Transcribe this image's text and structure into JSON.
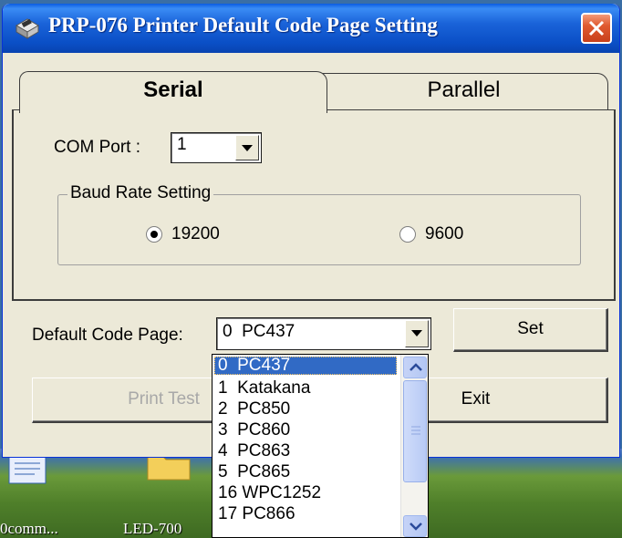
{
  "window": {
    "title": "PRP-076 Printer Default Code Page Setting"
  },
  "tabs": [
    {
      "label": "Serial",
      "active": true
    },
    {
      "label": "Parallel",
      "active": false
    }
  ],
  "serial": {
    "com_port_label": "COM Port :",
    "com_port_value": "1",
    "baud_group_title": "Baud Rate Setting",
    "baud_options": [
      {
        "label": "19200",
        "selected": true
      },
      {
        "label": "9600",
        "selected": false
      }
    ]
  },
  "code_page": {
    "label": "Default Code Page:",
    "value": "0  PC437",
    "options": [
      "0  PC437",
      "1  Katakana",
      "2  PC850",
      "3  PC860",
      "4  PC863",
      "5  PC865",
      "16 WPC1252",
      "17 PC866"
    ],
    "highlighted_index": 0
  },
  "buttons": {
    "set": "Set",
    "print_test": "Print Test",
    "exit": "Exit"
  },
  "desktop": {
    "icons": [
      {
        "label": "0comm..."
      },
      {
        "label": "LED-700"
      }
    ]
  },
  "colors": {
    "titlebar": "#0a4fc6",
    "selection": "#316ac5",
    "close": "#e05a30",
    "window_bg": "#ece9d8"
  }
}
